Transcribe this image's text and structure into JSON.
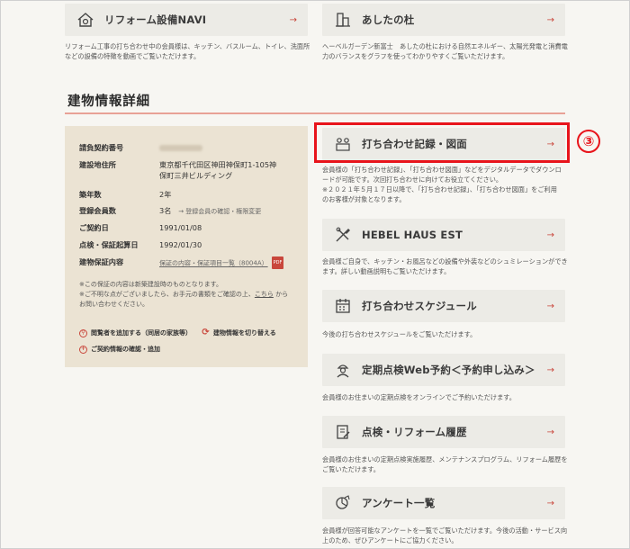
{
  "top_cards": [
    {
      "label": "リフォーム設備NAVI",
      "icon": "house-gear-icon",
      "desc": [
        "リフォーム工事の打ち合わせ中の会員様は、キッチン、バスルーム、トイレ、洗面所",
        "などの設備の特徴を動画でご覧いただけます。"
      ]
    },
    {
      "label": "あしたの杜",
      "icon": "building-icon",
      "desc": [
        "ヘーベルガーデン新富士　あしたの杜における自然エネルギー、太陽光発電と消費電",
        "力のバランスをグラフを使ってわかりやすくご覧いただけます。"
      ]
    }
  ],
  "section_title": "建物情報詳細",
  "info": {
    "contract_label": "請負契約番号",
    "address_label": "建設地住所",
    "address_value_1": "東京都千代田区神田神保町1-105神",
    "address_value_2": "保町三井ビルディング",
    "age_label": "築年数",
    "age_value": "2年",
    "members_label": "登録会員数",
    "members_value": "3名",
    "members_link": "→ 登録会員の確認・権限変更",
    "contract_date_label": "ご契約日",
    "contract_date_value": "1991/01/08",
    "inspection_label": "点検・保証起算日",
    "inspection_value": "1992/01/30",
    "warranty_label": "建物保証内容",
    "warranty_link": "保証の内容・保証項目一覧（8004A）",
    "warranty_badge": "PDF",
    "note_1": "※この保証の内容は新築建設時のものとなります。",
    "note_2a": "※ご不明な点がございましたら、お手元の書類をご確認の上、",
    "note_2_link": "こちら",
    "note_2b": "から",
    "note_3": "お問い合わせください。",
    "action_add_viewer": "閲覧者を追加する（同居の家族等）",
    "action_switch": "建物情報を切り替える",
    "action_contract": "ご契約情報の確認・追加"
  },
  "menu_cards": [
    {
      "label": "打ち合わせ記録・図面",
      "icon": "meeting-record-icon",
      "desc": [
        "会員様の「打ち合わせ記録」、「打ち合わせ図面」などをデジタルデータでダウンロ",
        "ードが可能です。次回打ち合わせに向けてお役立てください。",
        "※２０２１年５月１７日以降で、「打ち合わせ記録」、「打ち合わせ図面」をご利用",
        "のお客様が対象となります。"
      ]
    },
    {
      "label": "HEBEL HAUS EST",
      "icon": "tools-icon",
      "desc": [
        "会員様ご自身で、キッチン・お風呂などの設備や外装などのシュミレーションができ",
        "ます。詳しい動画説明もご覧いただけます。"
      ]
    },
    {
      "label": "打ち合わせスケジュール",
      "icon": "calendar-icon",
      "desc": [
        "今後の打ち合わせスケジュールをご覧いただけます。"
      ]
    },
    {
      "label": "定期点検Web予約＜予約申し込み＞",
      "icon": "inspector-icon",
      "desc": [
        "会員様のお住まいの定期点検をオンラインでご予約いただけます。"
      ]
    },
    {
      "label": "点検・リフォーム履歴",
      "icon": "history-icon",
      "desc": [
        "会員様のお住まいの定期点検実施履歴、メンテナンスプログラム、リフォーム履歴を",
        "ご覧いただけます。"
      ]
    },
    {
      "label": "アンケート一覧",
      "icon": "survey-icon",
      "desc": [
        "会員様が回答可能なアンケートを一覧でご覧いただけます。今後の活動・サービス向",
        "上のため、ぜひアンケートにご協力ください。"
      ]
    }
  ],
  "arrow": "→",
  "step_marker": "③",
  "colors": {
    "accent": "#c9463b",
    "highlight": "#e8141b",
    "card_bg": "#ecebe6",
    "panel_bg": "#ebe3d3"
  }
}
